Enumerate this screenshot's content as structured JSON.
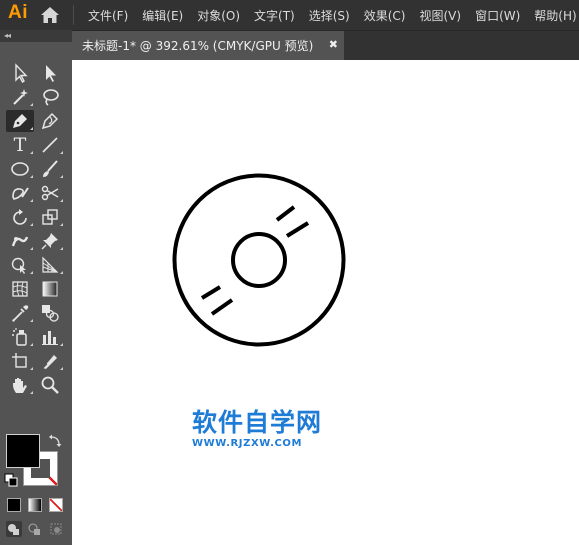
{
  "app": {
    "logo": "Ai"
  },
  "menu": {
    "items": [
      "文件(F)",
      "编辑(E)",
      "对象(O)",
      "文字(T)",
      "选择(S)",
      "效果(C)",
      "视图(V)",
      "窗口(W)",
      "帮助(H)"
    ]
  },
  "document": {
    "tab_title": "未标题-1* @ 392.61% (CMYK/GPU 预览)",
    "close_glyph": "✖"
  },
  "toolbar": {
    "collapse_glyph": "◂◂",
    "tools": [
      {
        "id": "selection",
        "icon": "selection-arrow-icon"
      },
      {
        "id": "direct-selection",
        "icon": "direct-selection-arrow-icon"
      },
      {
        "id": "magic-wand",
        "icon": "magic-wand-icon"
      },
      {
        "id": "lasso",
        "icon": "lasso-icon"
      },
      {
        "id": "pen",
        "icon": "pen-icon",
        "active": true
      },
      {
        "id": "curvature",
        "icon": "curvature-pen-icon"
      },
      {
        "id": "type",
        "icon": "type-icon",
        "glyph": "T"
      },
      {
        "id": "line",
        "icon": "line-segment-icon"
      },
      {
        "id": "ellipse",
        "icon": "ellipse-icon"
      },
      {
        "id": "paintbrush",
        "icon": "paintbrush-icon"
      },
      {
        "id": "shaper",
        "icon": "shaper-icon"
      },
      {
        "id": "scissors",
        "icon": "scissors-icon"
      },
      {
        "id": "rotate",
        "icon": "rotate-icon"
      },
      {
        "id": "scale",
        "icon": "scale-icon"
      },
      {
        "id": "puppet-warp",
        "icon": "puppet-warp-icon"
      },
      {
        "id": "pin",
        "icon": "pin-icon"
      },
      {
        "id": "shape-builder",
        "icon": "shape-builder-icon"
      },
      {
        "id": "perspective-grid",
        "icon": "perspective-grid-icon"
      },
      {
        "id": "mesh",
        "icon": "mesh-icon"
      },
      {
        "id": "gradient",
        "icon": "gradient-icon"
      },
      {
        "id": "eyedropper",
        "icon": "eyedropper-icon"
      },
      {
        "id": "blend",
        "icon": "blend-icon"
      },
      {
        "id": "symbol-sprayer",
        "icon": "symbol-sprayer-icon"
      },
      {
        "id": "column-graph",
        "icon": "column-graph-icon"
      },
      {
        "id": "artboard",
        "icon": "artboard-icon"
      },
      {
        "id": "slice",
        "icon": "slice-icon"
      },
      {
        "id": "hand",
        "icon": "hand-icon"
      },
      {
        "id": "zoom",
        "icon": "zoom-icon"
      }
    ],
    "fill_color": "#000000",
    "stroke_color": "none"
  },
  "watermark": {
    "title": "软件自学网",
    "url": "WWW.RJZXW.COM",
    "color": "#1e7bd6"
  },
  "colors": {
    "app_bg": "#323232",
    "panel_bg": "#535353",
    "accent_logo": "#ff9a00",
    "canvas_bg": "#ffffff"
  }
}
